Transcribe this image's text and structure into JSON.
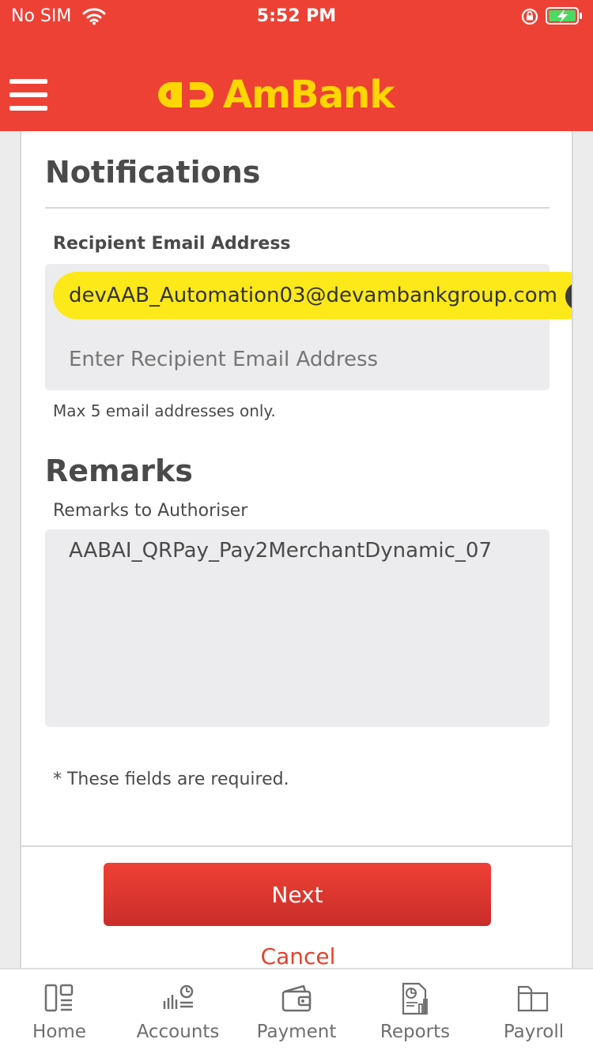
{
  "status_bar": {
    "carrier": "No SIM",
    "time": "5:52 PM"
  },
  "header": {
    "brand": "AmBank"
  },
  "notifications": {
    "title": "Notifications",
    "recipient_label": "Recipient Email Address",
    "chip_email": "devAAB_Automation03@devambankgroup.com",
    "input_placeholder": "Enter Recipient Email Address",
    "input_value": "",
    "help": "Max 5 email addresses only."
  },
  "remarks": {
    "title": "Remarks",
    "label": "Remarks to Authoriser",
    "value": "AABAI_QRPay_Pay2MerchantDynamic_07"
  },
  "footer_note": "* These fields are required.",
  "actions": {
    "next": "Next",
    "cancel": "Cancel"
  },
  "tabbar": {
    "home": "Home",
    "accounts": "Accounts",
    "payment": "Payment",
    "reports": "Reports",
    "payroll": "Payroll"
  },
  "colors": {
    "brand_red": "#ee4135",
    "brand_yellow": "#ffd700",
    "chip_yellow": "#fde91a"
  }
}
